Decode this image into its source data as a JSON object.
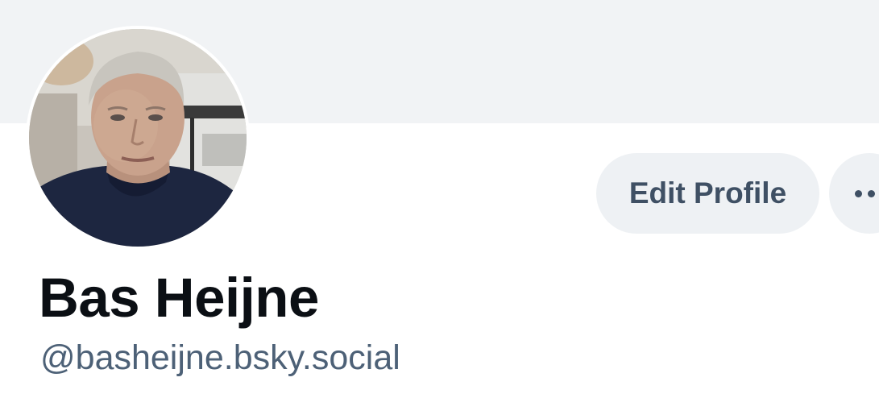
{
  "profile": {
    "display_name": "Bas Heijne",
    "handle": "@basheijne.bsky.social",
    "avatar_alt": "avatar"
  },
  "actions": {
    "edit_label": "Edit Profile",
    "more_icon": "ellipsis-icon"
  },
  "colors": {
    "banner": "#f1f3f5",
    "button_bg": "#eef1f4",
    "button_text": "#3f5064",
    "name_text": "#0b0f14",
    "handle_text": "#4d6177"
  }
}
